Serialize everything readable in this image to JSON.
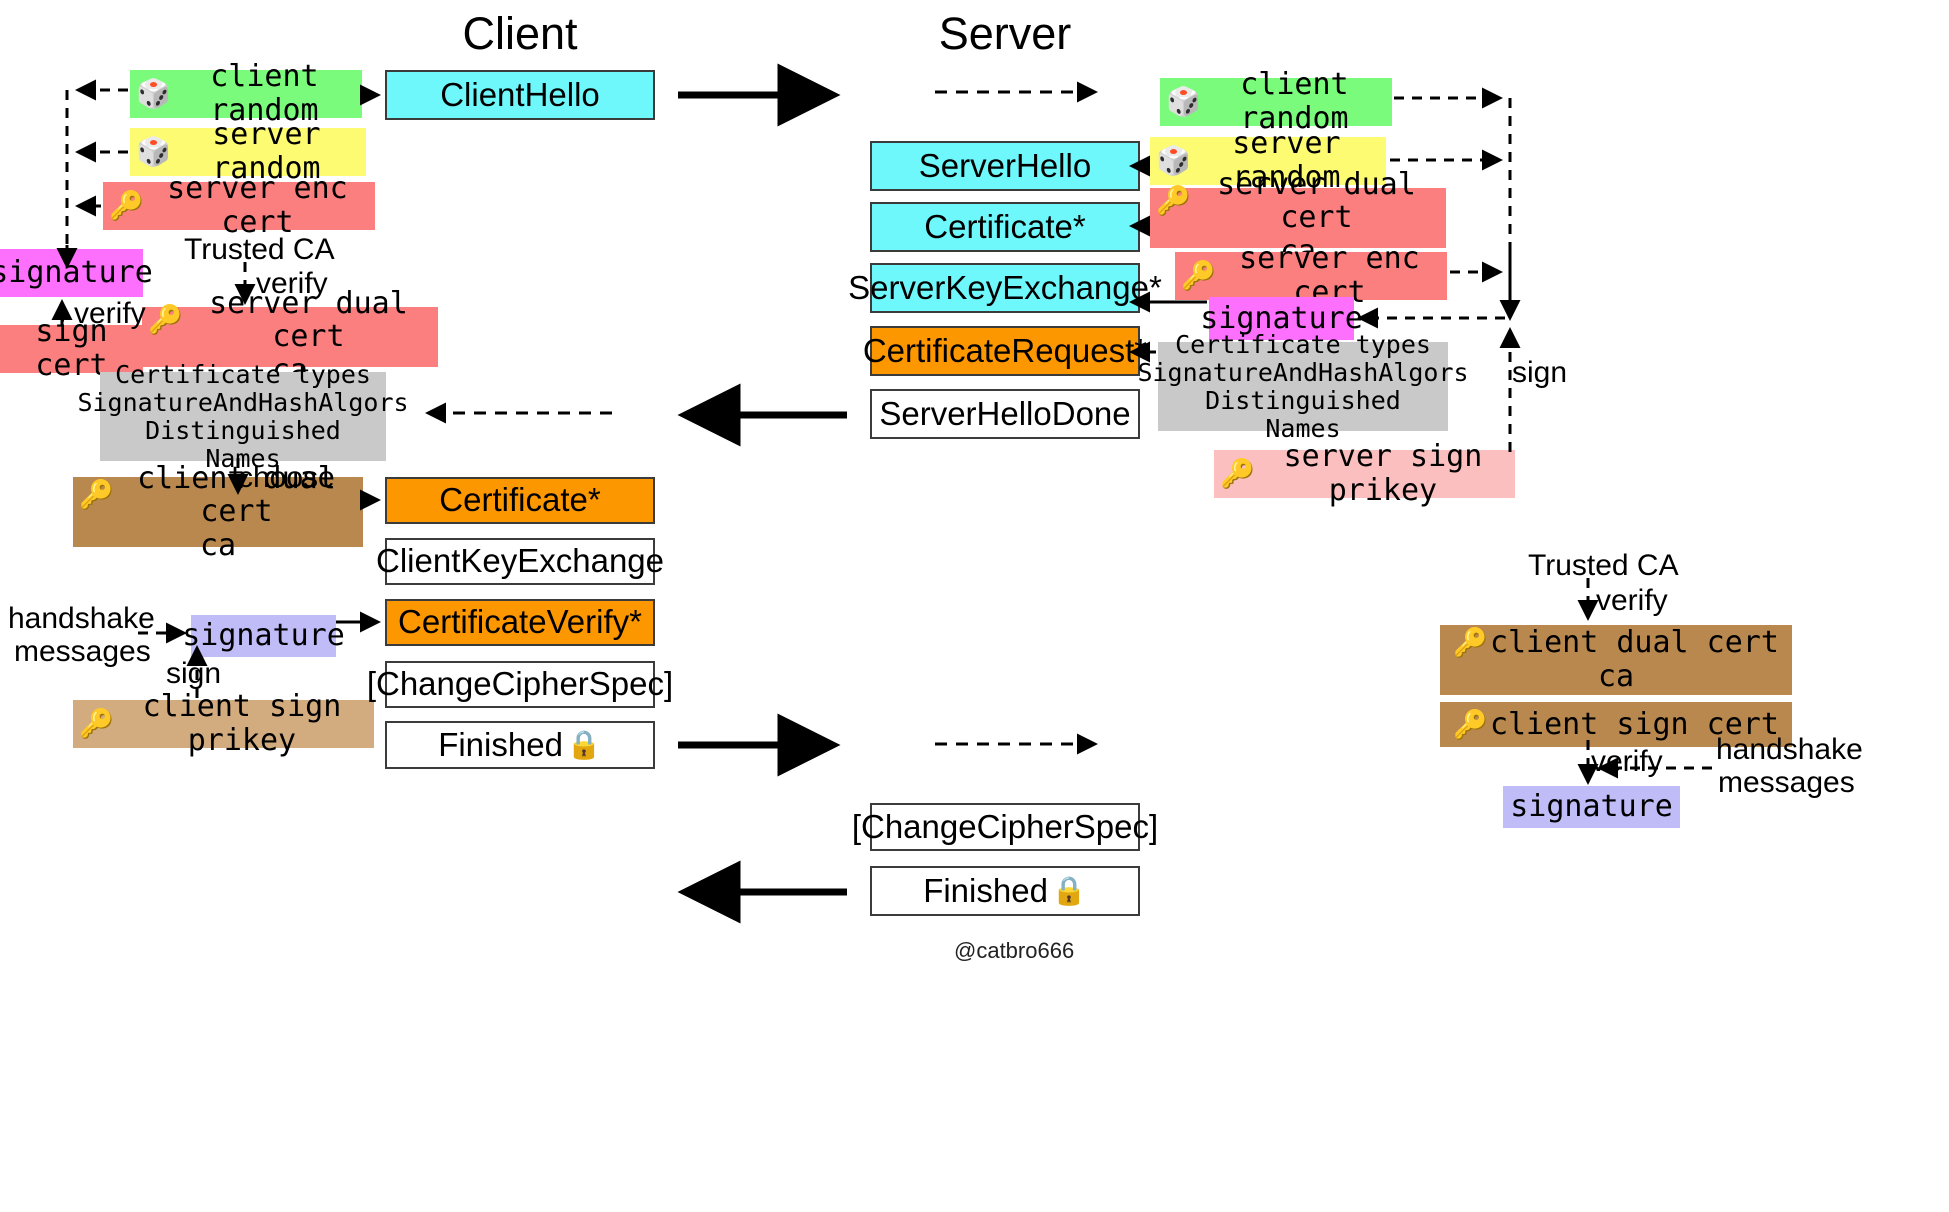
{
  "headings": {
    "client": "Client",
    "server": "Server"
  },
  "watermark": "@catbro666",
  "icons": {
    "die": "🎲",
    "key": "🔑",
    "lock": "🔒"
  },
  "colors": {
    "cyan": "#6ff8fb",
    "orange": "#fd9700",
    "white": "#ffffff",
    "green": "#7bfb7b",
    "yellow": "#fdfb71",
    "salmon": "#fb7f7f",
    "magenta": "#fd70fd",
    "grey": "#c9c9c9",
    "brown": "#b9884e",
    "tan": "#d2ac7f",
    "pink": "#fcbfbf",
    "periwinkle": "#c0bcf8",
    "border": "#3b3b3b"
  },
  "client_side": {
    "chips": {
      "client_random": "client random",
      "server_random": "server random",
      "server_enc_cert": "server enc cert",
      "signature": "signature",
      "sign_cert": "sign cert",
      "server_dual_cert_l1": "server dual cert",
      "server_dual_cert_l2": "ca",
      "cert_req_l1": "Certificate types",
      "cert_req_l2": "SignatureAndHashAlgors",
      "cert_req_l3": "Distinguished Names",
      "client_dual_cert_l1": "client dual cert",
      "client_dual_cert_l2": "ca",
      "client_signature": "signature",
      "client_sign_prikey": "client sign prikey"
    },
    "labels": {
      "trusted_ca": "Trusted CA",
      "verify_ca": "verify",
      "verify_sig": "verify",
      "choose": "choose",
      "handshake_l1": "handshake",
      "handshake_l2": "messages",
      "sign": "sign"
    }
  },
  "client_messages": [
    "ClientHello",
    "Certificate*",
    "ClientKeyExchange",
    "CertificateVerify*",
    "[ChangeCipherSpec]",
    "Finished"
  ],
  "server_messages": [
    "ServerHello",
    "Certificate*",
    "ServerKeyExchange*",
    "CertificateRequest*",
    "ServerHelloDone",
    "[ChangeCipherSpec]",
    "Finished"
  ],
  "server_side": {
    "chips": {
      "client_random": "client random",
      "server_random": "server random",
      "server_dual_cert_l1": "server dual cert",
      "server_dual_cert_l2": "ca",
      "server_enc_cert": "server enc cert",
      "signature": "signature",
      "cert_req_l1": "Certificate types",
      "cert_req_l2": "SignatureAndHashAlgors",
      "cert_req_l3": "Distinguished Names",
      "server_sign_prikey": "server sign prikey",
      "client_dual_cert_l1": "client dual cert",
      "client_dual_cert_l2": "ca",
      "client_sign_cert": "client sign cert",
      "client_signature": "signature"
    },
    "labels": {
      "sign": "sign",
      "trusted_ca": "Trusted CA",
      "verify_ca": "verify",
      "verify_sig": "verify",
      "handshake_l1": "handshake",
      "handshake_l2": "messages"
    }
  }
}
